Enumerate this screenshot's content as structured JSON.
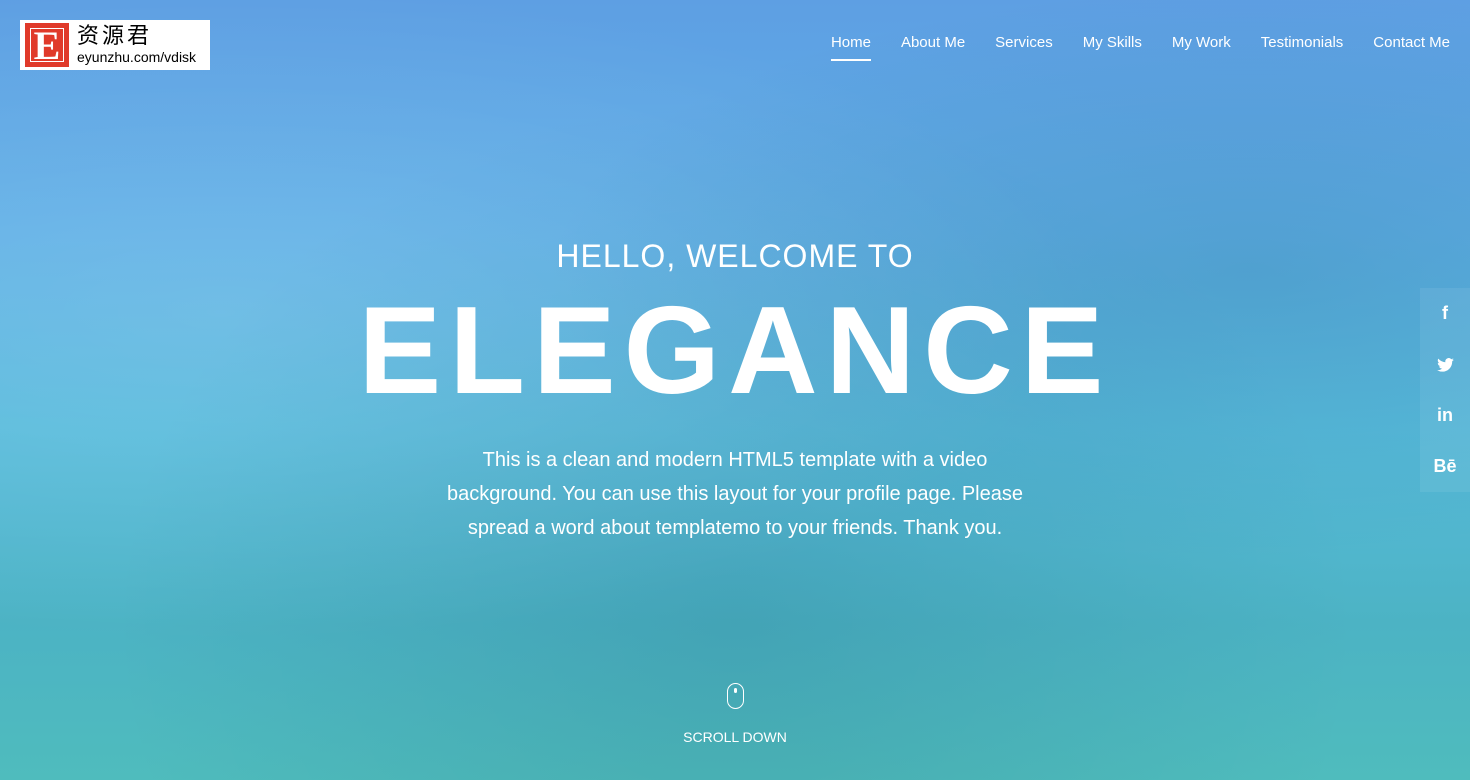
{
  "logo": {
    "letter": "E",
    "chinese": "资源君",
    "url": "eyunzhu.com/vdisk"
  },
  "nav": {
    "items": [
      "Home",
      "About Me",
      "Services",
      "My Skills",
      "My Work",
      "Testimonials",
      "Contact Me"
    ],
    "active": "Home"
  },
  "hero": {
    "subtitle": "HELLO, WELCOME TO",
    "title": "ELEGANCE",
    "description": "This is a clean and modern HTML5 template with a video background. You can use this layout for your profile page. Please spread a word about templatemo to your friends. Thank you."
  },
  "social": [
    {
      "icon": "facebook-icon",
      "glyph": "f"
    },
    {
      "icon": "twitter-icon",
      "glyph": "🐦"
    },
    {
      "icon": "linkedin-icon",
      "glyph": "in"
    },
    {
      "icon": "behance-icon",
      "glyph": "Bē"
    }
  ],
  "scroll": {
    "label": "SCROLL DOWN"
  }
}
